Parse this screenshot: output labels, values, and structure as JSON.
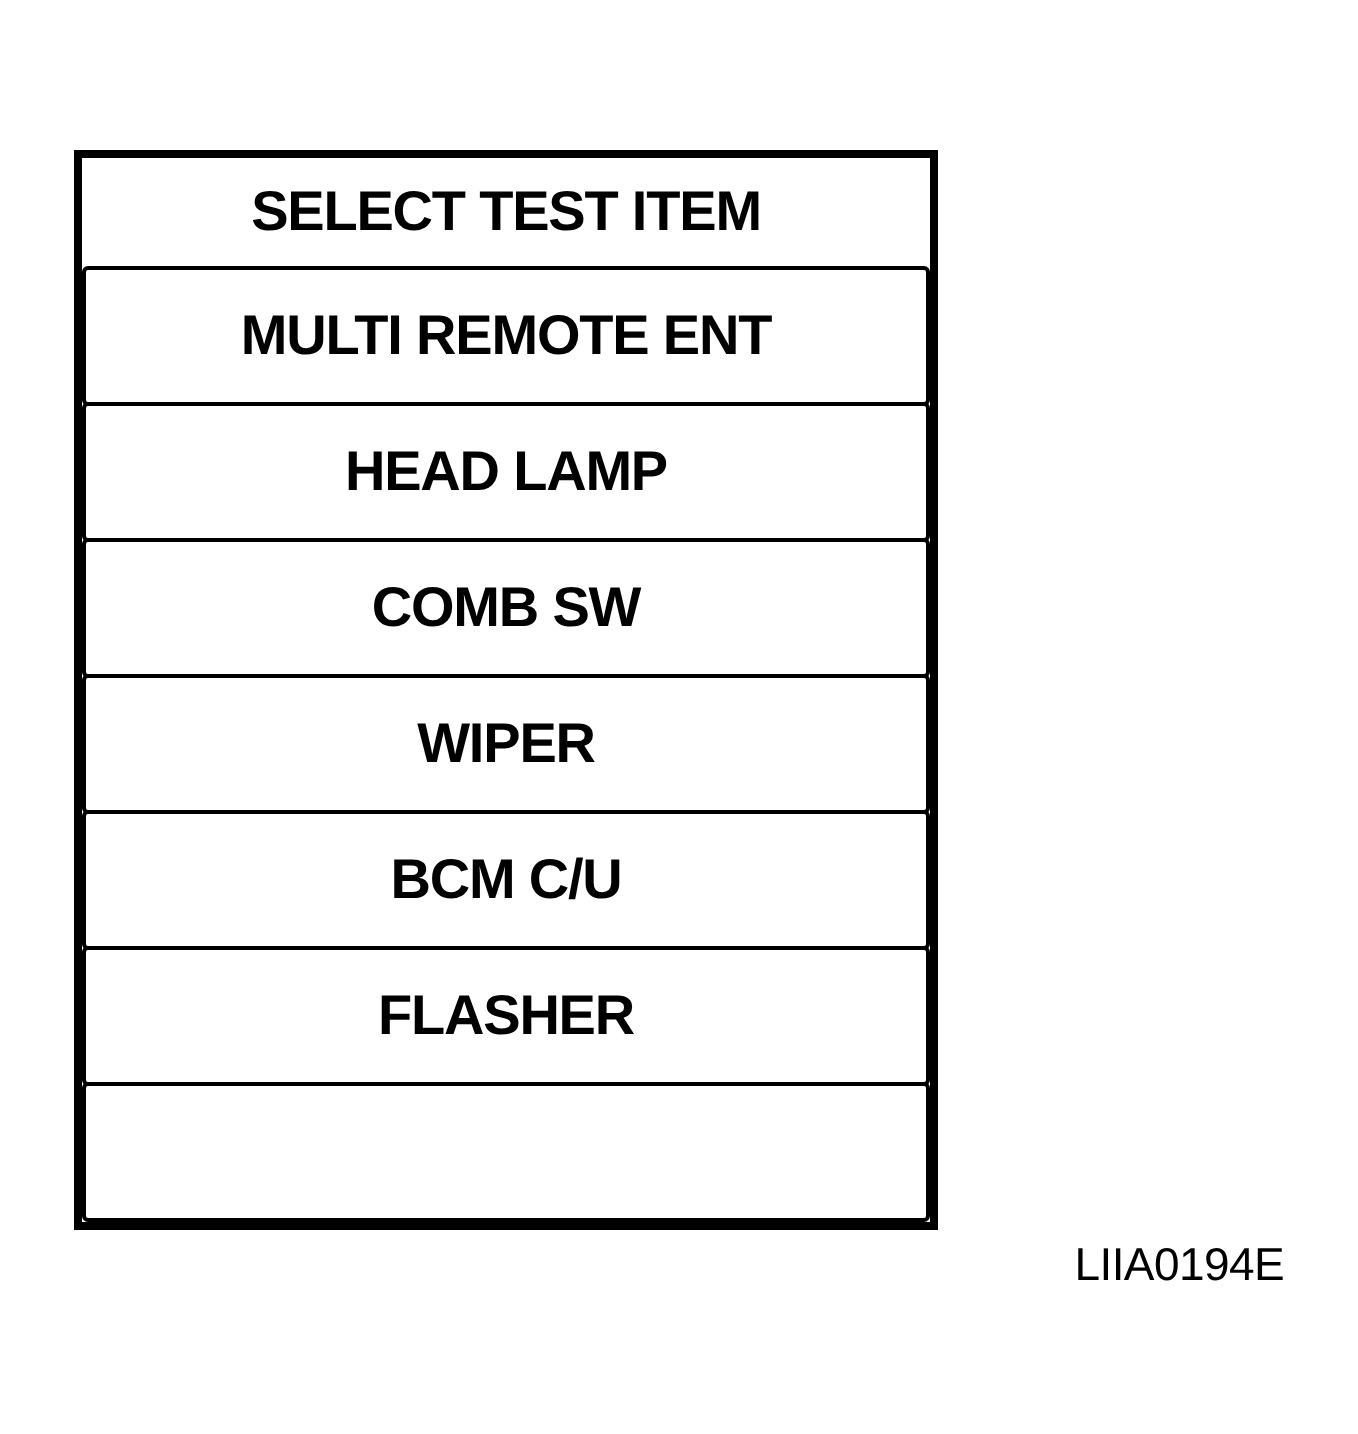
{
  "panel": {
    "title": "SELECT TEST ITEM",
    "items": [
      {
        "label": "MULTI REMOTE ENT"
      },
      {
        "label": "HEAD LAMP"
      },
      {
        "label": "COMB SW"
      },
      {
        "label": "WIPER"
      },
      {
        "label": "BCM C/U"
      },
      {
        "label": "FLASHER"
      }
    ]
  },
  "figure_code": "LIIA0194E"
}
